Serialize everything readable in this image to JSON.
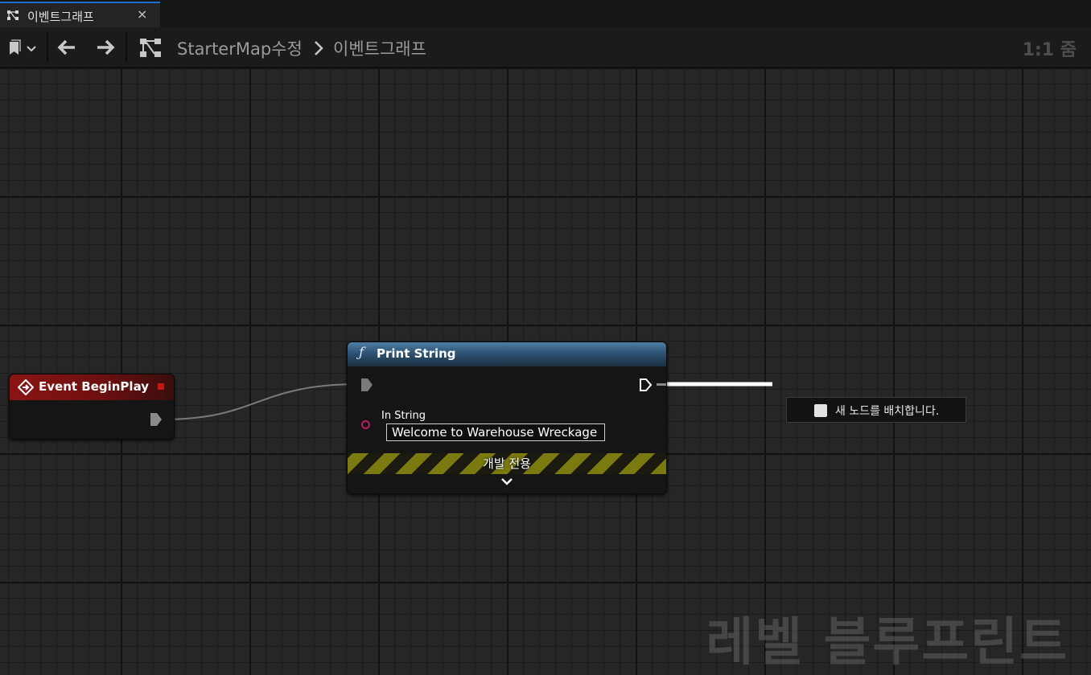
{
  "tab": {
    "label": "이벤트그래프",
    "close": "×"
  },
  "toolbar": {
    "breadcrumb": [
      "StarterMap수정",
      "이벤트그래프"
    ],
    "zoom": "1:1 줌"
  },
  "nodes": {
    "event_begin_play": {
      "title": "Event BeginPlay"
    },
    "print_string": {
      "title": "Print String",
      "in_string_label": "In String",
      "in_string_value": "Welcome to Warehouse Wreckage",
      "dev_only": "개발 전용"
    }
  },
  "hint": {
    "text": "새 노드를 배치합니다."
  },
  "watermark": "레벨 블루프린트",
  "colors": {
    "accent": "#1e6fd0",
    "event_header": "#8b1414",
    "function_header": "#2d5272",
    "string_pin": "#c01a6b",
    "exec_pin": "#ffffff"
  }
}
